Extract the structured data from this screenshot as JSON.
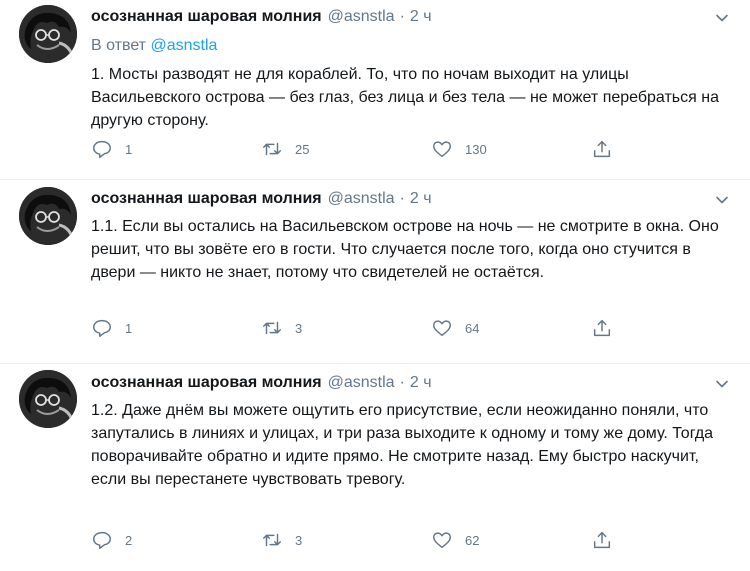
{
  "tweets": [
    {
      "author_name": "осознанная шаровая молния",
      "handle": "@asnstla",
      "separator": "·",
      "time": "2 ч",
      "reply_prefix": "В ответ",
      "reply_to": "@asnstla",
      "text": "1. Мосты разводят не для кораблей. То, что по ночам выходит на улицы Васильевского острова — без глаз, без лица и без тела — не может перебраться на другую сторону.",
      "replies": "1",
      "retweets": "25",
      "likes": "130"
    },
    {
      "author_name": "осознанная шаровая молния",
      "handle": "@asnstla",
      "separator": "·",
      "time": "2 ч",
      "text": "1.1. Если вы остались на Васильевском острове на ночь — не смотрите в окна. Оно решит, что вы зовёте его в гости. Что случается после того, когда оно стучится в двери — никто не знает, потому что свидетелей не остаётся.",
      "replies": "1",
      "retweets": "3",
      "likes": "64"
    },
    {
      "author_name": "осознанная шаровая молния",
      "handle": "@asnstla",
      "separator": "·",
      "time": "2 ч",
      "text": "1.2. Даже днём вы можете ощутить его присутствие, если неожиданно поняли, что запутались в линиях и улицах, и три раза выходите к одному и тому же дому. Тогда поворачивайте обратно и идите прямо. Не смотрите назад. Ему быстро наскучит, если вы перестанете чувствовать тревогу.",
      "replies": "2",
      "retweets": "3",
      "likes": "62"
    }
  ],
  "icons": {
    "reply": "reply-icon",
    "retweet": "retweet-icon",
    "like": "heart-icon",
    "share": "share-icon",
    "more": "chevron-down-icon"
  },
  "colors": {
    "text": "#14171a",
    "secondary": "#657786",
    "link": "#1da1f2",
    "divider": "#e6ecf0"
  }
}
